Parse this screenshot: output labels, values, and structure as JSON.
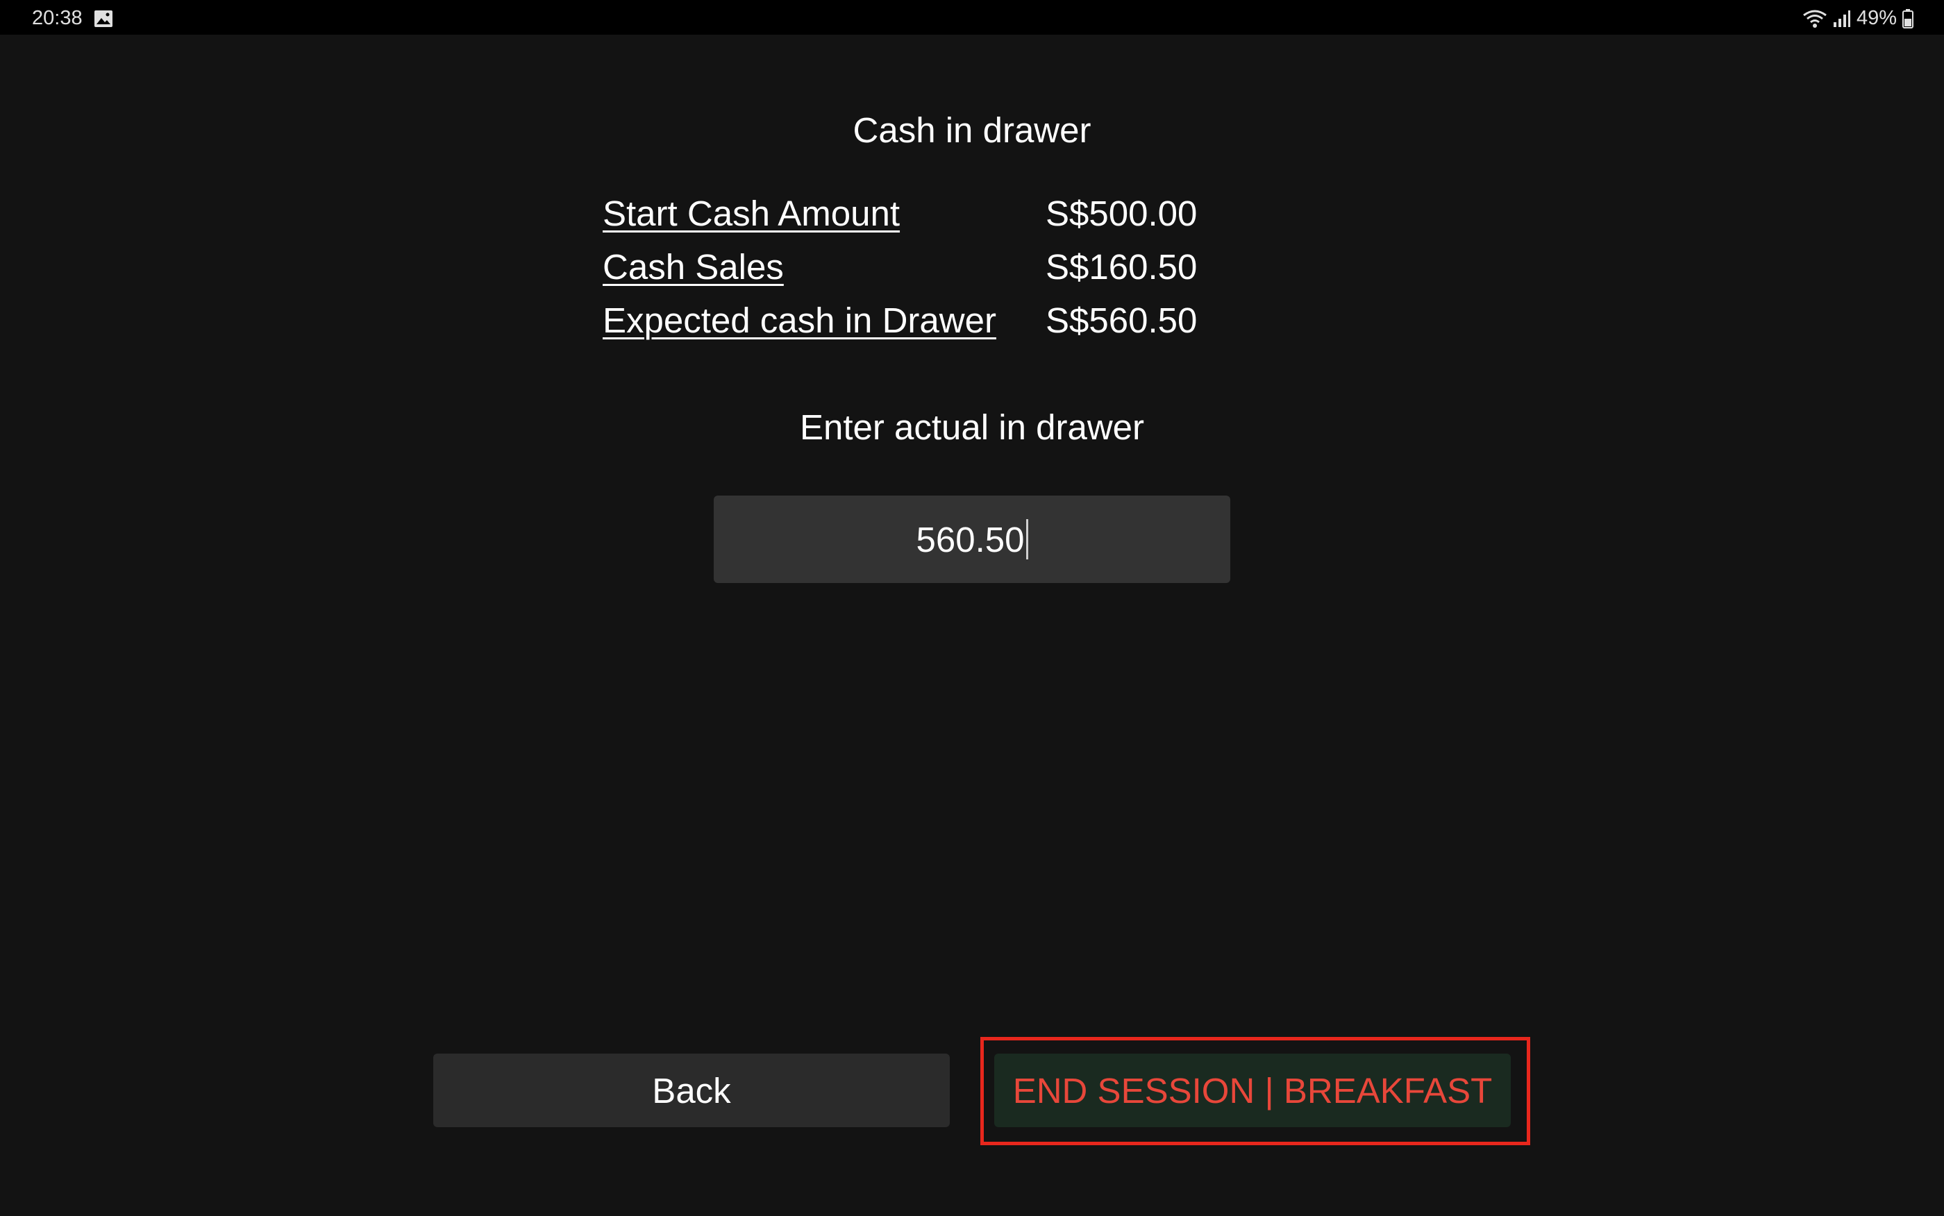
{
  "status_bar": {
    "time": "20:38",
    "battery": "49%",
    "icons": [
      "gallery-notification-icon",
      "wifi-icon",
      "signal-icon",
      "battery-icon"
    ]
  },
  "screen": {
    "title": "Cash in drawer",
    "summary": [
      {
        "label": "Start Cash Amount",
        "value": "S$500.00"
      },
      {
        "label": "Cash Sales",
        "value": "S$160.50"
      },
      {
        "label": "Expected cash in Drawer",
        "value": "S$560.50"
      }
    ],
    "input_prompt": "Enter actual in drawer",
    "actual_amount": "560.50"
  },
  "actions": {
    "back_label": "Back",
    "end_session_label": "END SESSION | BREAKFAST"
  },
  "colors": {
    "background": "#131313",
    "input_background": "#333333",
    "back_button": "#2b2b2b",
    "end_button_background": "#1a2a20",
    "end_button_text": "#e8473a",
    "highlight": "#e8271d"
  }
}
